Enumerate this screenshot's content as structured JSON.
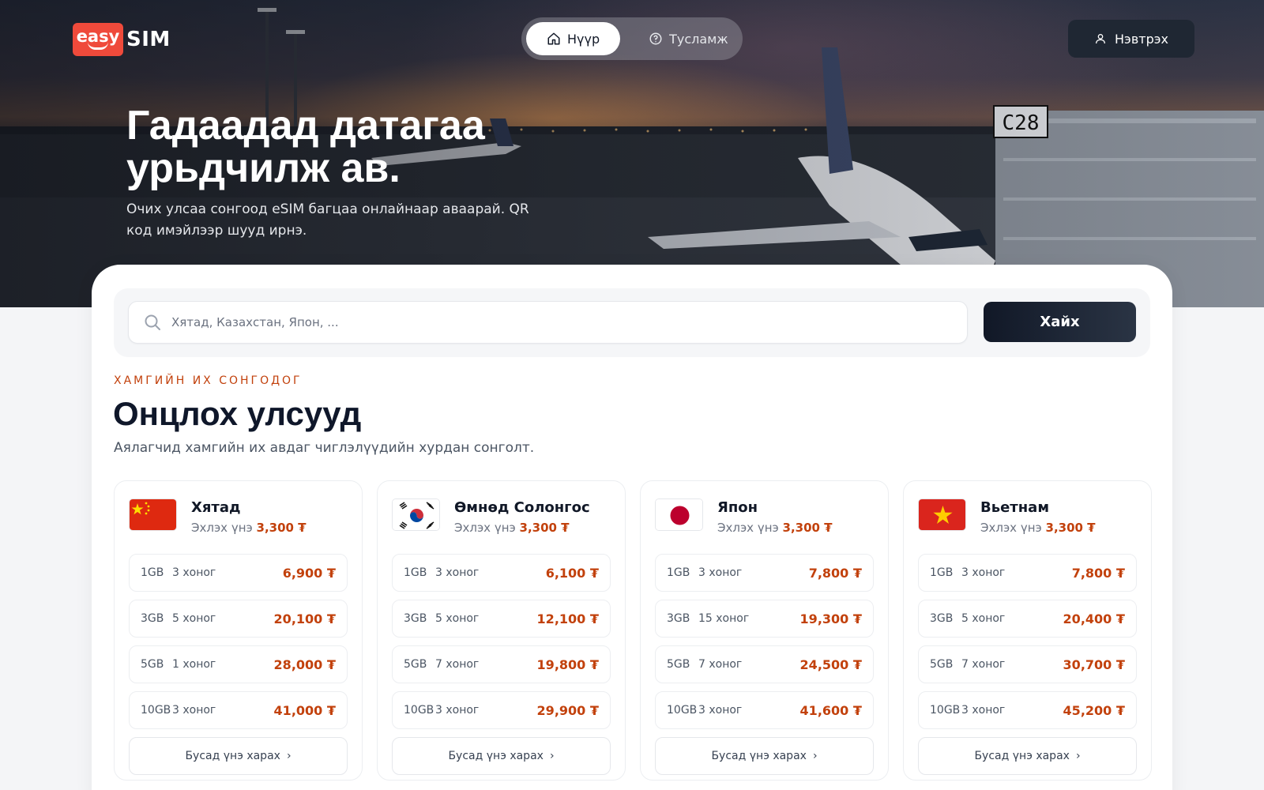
{
  "brand": {
    "logo_text": "easy",
    "logo_suffix": "SIM"
  },
  "nav": {
    "items": [
      {
        "label": "Нүүр",
        "icon": "home-icon",
        "active": true
      },
      {
        "label": "Тусламж",
        "icon": "help-circle-icon",
        "active": false
      }
    ],
    "login_label": "Нэвтрэх"
  },
  "hero": {
    "title_line1": "Гадаадад датагаа",
    "title_line2": "урьдчилж ав.",
    "subtitle": "Очих улсаа сонгоод eSIM багцаа онлайнаар аваарай. QR код имэйлээр шууд ирнэ."
  },
  "search": {
    "placeholder": "Хятад, Казахстан, Япон, ...",
    "button_label": "Хайх"
  },
  "section": {
    "eyebrow": "ХАМГИЙН ИХ СОНГОДОГ",
    "title": "Онцлох улсууд",
    "subtitle": "Аялагчид хамгийн их авдаг чиглэлүүдийн хурдан сонголт."
  },
  "colors": {
    "accent": "#c2410c",
    "dark": "#111827"
  },
  "countries": [
    {
      "name": "Хятад",
      "flag": "china-flag",
      "from_label": "Эхлэх үнэ",
      "from_price": "3,300 ₮",
      "plans": [
        {
          "gb": "1GB",
          "days": "3 хоног",
          "price": "6,900 ₮"
        },
        {
          "gb": "3GB",
          "days": "5 хоног",
          "price": "20,100 ₮"
        },
        {
          "gb": "5GB",
          "days": "1 хоног",
          "price": "28,000 ₮"
        },
        {
          "gb": "10GB",
          "days": "3 хоног",
          "price": "41,000 ₮"
        }
      ],
      "more_label": "Бусад үнэ харах"
    },
    {
      "name": "Өмнөд Солонгос",
      "flag": "south-korea-flag",
      "from_label": "Эхлэх үнэ",
      "from_price": "3,300 ₮",
      "plans": [
        {
          "gb": "1GB",
          "days": "3 хоног",
          "price": "6,100 ₮"
        },
        {
          "gb": "3GB",
          "days": "5 хоног",
          "price": "12,100 ₮"
        },
        {
          "gb": "5GB",
          "days": "7 хоног",
          "price": "19,800 ₮"
        },
        {
          "gb": "10GB",
          "days": "3 хоног",
          "price": "29,900 ₮"
        }
      ],
      "more_label": "Бусад үнэ харах"
    },
    {
      "name": "Япон",
      "flag": "japan-flag",
      "from_label": "Эхлэх үнэ",
      "from_price": "3,300 ₮",
      "plans": [
        {
          "gb": "1GB",
          "days": "3 хоног",
          "price": "7,800 ₮"
        },
        {
          "gb": "3GB",
          "days": "15 хоног",
          "price": "19,300 ₮"
        },
        {
          "gb": "5GB",
          "days": "7 хоног",
          "price": "24,500 ₮"
        },
        {
          "gb": "10GB",
          "days": "3 хоног",
          "price": "41,600 ₮"
        }
      ],
      "more_label": "Бусад үнэ харах"
    },
    {
      "name": "Вьетнам",
      "flag": "vietnam-flag",
      "from_label": "Эхлэх үнэ",
      "from_price": "3,300 ₮",
      "plans": [
        {
          "gb": "1GB",
          "days": "3 хоног",
          "price": "7,800 ₮"
        },
        {
          "gb": "3GB",
          "days": "5 хоног",
          "price": "20,400 ₮"
        },
        {
          "gb": "5GB",
          "days": "7 хоног",
          "price": "30,700 ₮"
        },
        {
          "gb": "10GB",
          "days": "3 хоног",
          "price": "45,200 ₮"
        }
      ],
      "more_label": "Бусад үнэ харах"
    }
  ]
}
